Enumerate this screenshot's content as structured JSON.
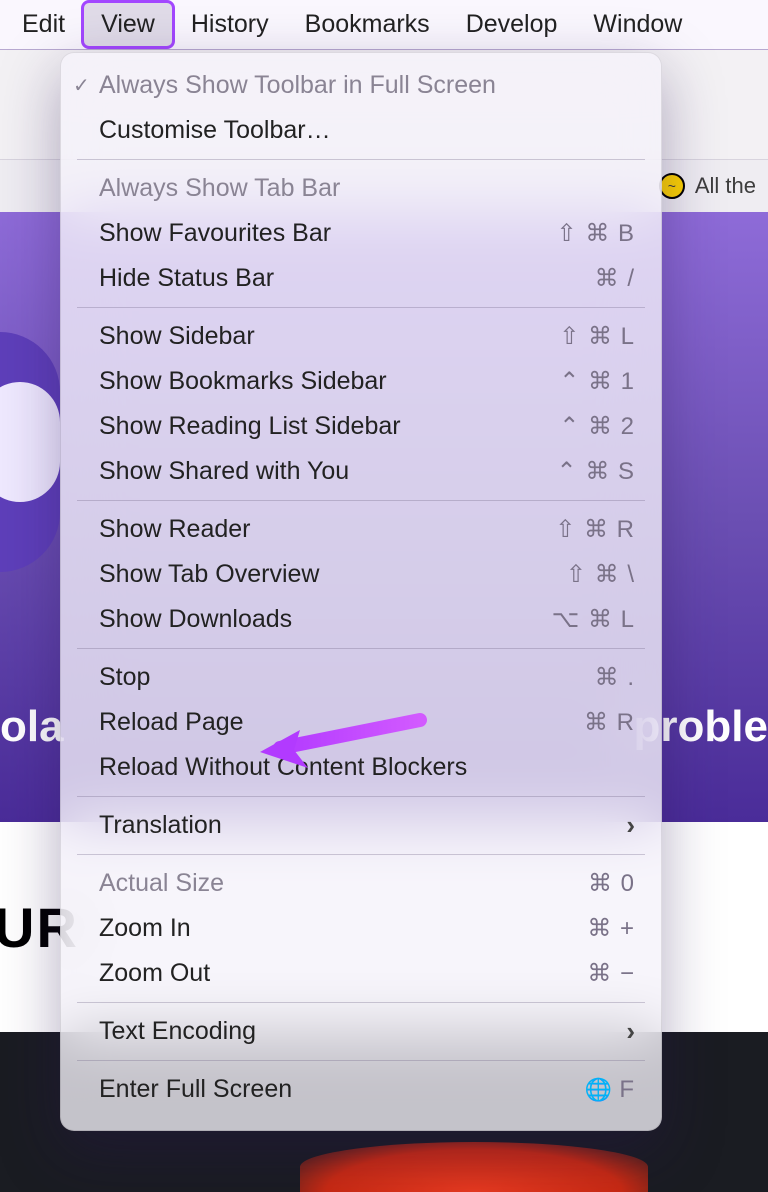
{
  "menubar": {
    "items": [
      "Edit",
      "View",
      "History",
      "Bookmarks",
      "Develop",
      "Window"
    ],
    "active_index": 1
  },
  "bookmarks_bar": {
    "visible_label": "All the",
    "favicon_glyph": "~"
  },
  "hero": {
    "left_text": "ola",
    "right_text": "proble",
    "white_text": "UR"
  },
  "menu": {
    "sections": [
      [
        {
          "label": "Always Show Toolbar in Full Screen",
          "checked": true,
          "disabled": true,
          "shortcut": ""
        },
        {
          "label": "Customise Toolbar…",
          "shortcut": ""
        }
      ],
      [
        {
          "label": "Always Show Tab Bar",
          "disabled": true,
          "shortcut": ""
        },
        {
          "label": "Show Favourites Bar",
          "shortcut": "⇧ ⌘ B"
        },
        {
          "label": "Hide Status Bar",
          "shortcut": "⌘ /"
        }
      ],
      [
        {
          "label": "Show Sidebar",
          "shortcut": "⇧ ⌘ L"
        },
        {
          "label": "Show Bookmarks Sidebar",
          "shortcut": "⌃ ⌘ 1"
        },
        {
          "label": "Show Reading List Sidebar",
          "shortcut": "⌃ ⌘ 2"
        },
        {
          "label": "Show Shared with You",
          "shortcut": "⌃ ⌘ S"
        }
      ],
      [
        {
          "label": "Show Reader",
          "shortcut": "⇧ ⌘ R"
        },
        {
          "label": "Show Tab Overview",
          "shortcut": "⇧ ⌘ \\"
        },
        {
          "label": "Show Downloads",
          "shortcut": "⌥ ⌘ L"
        }
      ],
      [
        {
          "label": "Stop",
          "shortcut": "⌘ ."
        },
        {
          "label": "Reload Page",
          "shortcut": "⌘ R"
        },
        {
          "label": "Reload Without Content Blockers",
          "shortcut": ""
        }
      ],
      [
        {
          "label": "Translation",
          "submenu": true
        }
      ],
      [
        {
          "label": "Actual Size",
          "disabled": true,
          "shortcut": "⌘ 0"
        },
        {
          "label": "Zoom In",
          "shortcut": "⌘ +"
        },
        {
          "label": "Zoom Out",
          "shortcut": "⌘ −"
        }
      ],
      [
        {
          "label": "Text Encoding",
          "submenu": true
        }
      ],
      [
        {
          "label": "Enter Full Screen",
          "shortcut": "F",
          "globe": true
        }
      ]
    ]
  },
  "annotation": {
    "target_label": "Reload Page",
    "color": "#b23aff"
  }
}
